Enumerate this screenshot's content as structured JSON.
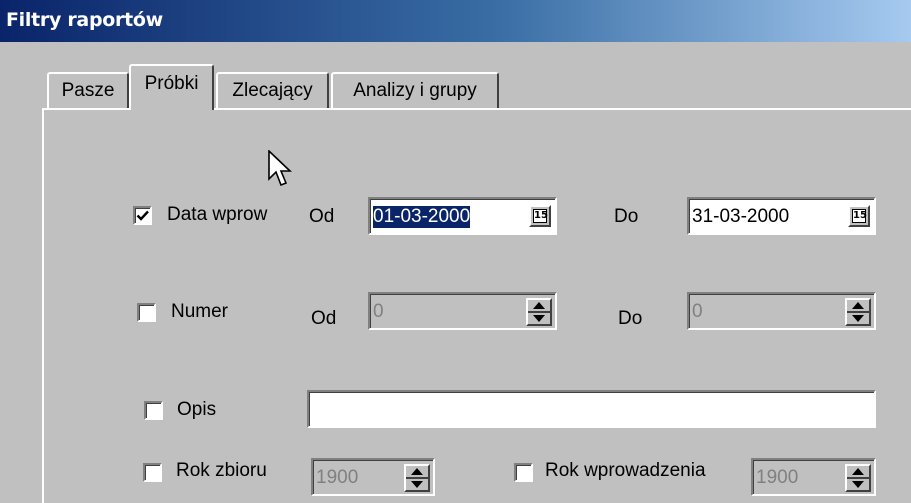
{
  "window": {
    "title": "Filtry raportów"
  },
  "tabs": [
    {
      "label": "Pasze",
      "active": false
    },
    {
      "label": "Próbki",
      "active": true
    },
    {
      "label": "Zlecający",
      "active": false
    },
    {
      "label": "Analizy i grupy",
      "active": false
    }
  ],
  "filters": {
    "data_wprow": {
      "label": "Data wprow",
      "checked": true,
      "od_label": "Od",
      "od_value": "01-03-2000",
      "do_label": "Do",
      "do_value": "31-03-2000",
      "cal_glyph": "15"
    },
    "numer": {
      "label": "Numer",
      "checked": false,
      "od_label": "Od",
      "od_value": "0",
      "do_label": "Do",
      "do_value": "0"
    },
    "opis": {
      "label": "Opis",
      "checked": false,
      "value": ""
    },
    "rok_zbioru": {
      "label": "Rok zbioru",
      "checked": false,
      "value": "1900"
    },
    "rok_wprowadzenia": {
      "label": "Rok wprowadzenia",
      "checked": false,
      "value": "1900"
    }
  },
  "colors": {
    "selection": "#0a246a",
    "titlebar": "#0a246a",
    "face": "#c0c0c0"
  }
}
